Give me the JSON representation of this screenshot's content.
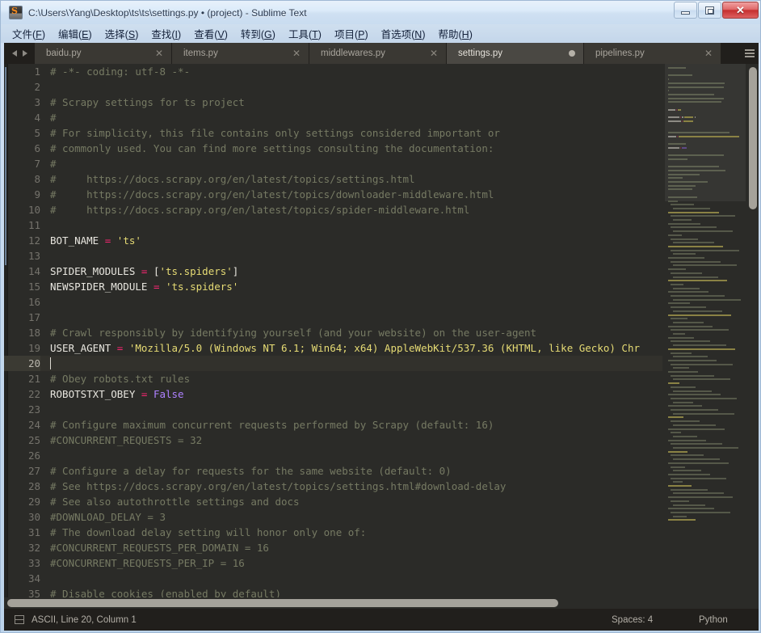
{
  "window": {
    "title": "C:\\Users\\Yang\\Desktop\\ts\\ts\\settings.py • (project) - Sublime Text",
    "icon": "sublime-text-icon",
    "controls": {
      "minimize": "—",
      "restore": "❐",
      "close": "✕"
    }
  },
  "menubar": {
    "items": [
      {
        "label": "文件",
        "mnemonic": "F"
      },
      {
        "label": "编辑",
        "mnemonic": "E"
      },
      {
        "label": "选择",
        "mnemonic": "S"
      },
      {
        "label": "查找",
        "mnemonic": "I"
      },
      {
        "label": "查看",
        "mnemonic": "V"
      },
      {
        "label": "转到",
        "mnemonic": "G"
      },
      {
        "label": "工具",
        "mnemonic": "T"
      },
      {
        "label": "项目",
        "mnemonic": "P"
      },
      {
        "label": "首选项",
        "mnemonic": "N"
      },
      {
        "label": "帮助",
        "mnemonic": "H"
      }
    ]
  },
  "tabs": {
    "nav_prev": "◀",
    "nav_next": "▶",
    "close_glyph": "✕",
    "items": [
      {
        "label": "baidu.py",
        "active": false,
        "dirty": false
      },
      {
        "label": "items.py",
        "active": false,
        "dirty": false
      },
      {
        "label": "middlewares.py",
        "active": false,
        "dirty": false
      },
      {
        "label": "settings.py",
        "active": true,
        "dirty": true
      },
      {
        "label": "pipelines.py",
        "active": false,
        "dirty": false
      }
    ]
  },
  "editor": {
    "cursor_line": 20,
    "lines": [
      {
        "n": 1,
        "tokens": [
          {
            "t": "cm",
            "s": "# -*- coding: utf-8 -*-"
          }
        ]
      },
      {
        "n": 2,
        "tokens": []
      },
      {
        "n": 3,
        "tokens": [
          {
            "t": "cm",
            "s": "# Scrapy settings for ts project"
          }
        ]
      },
      {
        "n": 4,
        "tokens": [
          {
            "t": "cm",
            "s": "#"
          }
        ]
      },
      {
        "n": 5,
        "tokens": [
          {
            "t": "cm",
            "s": "# For simplicity, this file contains only settings considered important or"
          }
        ]
      },
      {
        "n": 6,
        "tokens": [
          {
            "t": "cm",
            "s": "# commonly used. You can find more settings consulting the documentation:"
          }
        ]
      },
      {
        "n": 7,
        "tokens": [
          {
            "t": "cm",
            "s": "#"
          }
        ]
      },
      {
        "n": 8,
        "tokens": [
          {
            "t": "cm",
            "s": "#     https://docs.scrapy.org/en/latest/topics/settings.html"
          }
        ]
      },
      {
        "n": 9,
        "tokens": [
          {
            "t": "cm",
            "s": "#     https://docs.scrapy.org/en/latest/topics/downloader-middleware.html"
          }
        ]
      },
      {
        "n": 10,
        "tokens": [
          {
            "t": "cm",
            "s": "#     https://docs.scrapy.org/en/latest/topics/spider-middleware.html"
          }
        ]
      },
      {
        "n": 11,
        "tokens": []
      },
      {
        "n": 12,
        "tokens": [
          {
            "t": "var",
            "s": "BOT_NAME "
          },
          {
            "t": "op",
            "s": "="
          },
          {
            "t": "str",
            "s": " 'ts'"
          }
        ]
      },
      {
        "n": 13,
        "tokens": []
      },
      {
        "n": 14,
        "tokens": [
          {
            "t": "var",
            "s": "SPIDER_MODULES "
          },
          {
            "t": "op",
            "s": "="
          },
          {
            "t": "var",
            "s": " ["
          },
          {
            "t": "str",
            "s": "'ts.spiders'"
          },
          {
            "t": "var",
            "s": "]"
          }
        ]
      },
      {
        "n": 15,
        "tokens": [
          {
            "t": "var",
            "s": "NEWSPIDER_MODULE "
          },
          {
            "t": "op",
            "s": "="
          },
          {
            "t": "str",
            "s": " 'ts.spiders'"
          }
        ]
      },
      {
        "n": 16,
        "tokens": []
      },
      {
        "n": 17,
        "tokens": []
      },
      {
        "n": 18,
        "tokens": [
          {
            "t": "cm",
            "s": "# Crawl responsibly by identifying yourself (and your website) on the user-agent"
          }
        ]
      },
      {
        "n": 19,
        "tokens": [
          {
            "t": "var",
            "s": "USER_AGENT "
          },
          {
            "t": "op",
            "s": "="
          },
          {
            "t": "str",
            "s": " 'Mozilla/5.0 (Windows NT 6.1; Win64; x64) AppleWebKit/537.36 (KHTML, like Gecko) Chr"
          }
        ]
      },
      {
        "n": 20,
        "tokens": [],
        "cursor": true
      },
      {
        "n": 21,
        "tokens": [
          {
            "t": "cm",
            "s": "# Obey robots.txt rules"
          }
        ]
      },
      {
        "n": 22,
        "tokens": [
          {
            "t": "var",
            "s": "ROBOTSTXT_OBEY "
          },
          {
            "t": "op",
            "s": "="
          },
          {
            "t": "kw",
            "s": " False"
          }
        ]
      },
      {
        "n": 23,
        "tokens": []
      },
      {
        "n": 24,
        "tokens": [
          {
            "t": "cm",
            "s": "# Configure maximum concurrent requests performed by Scrapy (default: 16)"
          }
        ]
      },
      {
        "n": 25,
        "tokens": [
          {
            "t": "cm",
            "s": "#CONCURRENT_REQUESTS = 32"
          }
        ]
      },
      {
        "n": 26,
        "tokens": []
      },
      {
        "n": 27,
        "tokens": [
          {
            "t": "cm",
            "s": "# Configure a delay for requests for the same website (default: 0)"
          }
        ]
      },
      {
        "n": 28,
        "tokens": [
          {
            "t": "cm",
            "s": "# See https://docs.scrapy.org/en/latest/topics/settings.html#download-delay"
          }
        ]
      },
      {
        "n": 29,
        "tokens": [
          {
            "t": "cm",
            "s": "# See also autothrottle settings and docs"
          }
        ]
      },
      {
        "n": 30,
        "tokens": [
          {
            "t": "cm",
            "s": "#DOWNLOAD_DELAY = 3"
          }
        ]
      },
      {
        "n": 31,
        "tokens": [
          {
            "t": "cm",
            "s": "# The download delay setting will honor only one of:"
          }
        ]
      },
      {
        "n": 32,
        "tokens": [
          {
            "t": "cm",
            "s": "#CONCURRENT_REQUESTS_PER_DOMAIN = 16"
          }
        ]
      },
      {
        "n": 33,
        "tokens": [
          {
            "t": "cm",
            "s": "#CONCURRENT_REQUESTS_PER_IP = 16"
          }
        ]
      },
      {
        "n": 34,
        "tokens": []
      },
      {
        "n": 35,
        "tokens": [
          {
            "t": "cm",
            "s": "# Disable cookies (enabled by default)"
          }
        ]
      }
    ]
  },
  "statusbar": {
    "panel_icon": "panel-toggle-icon",
    "position": "ASCII, Line 20, Column 1",
    "indentation": "Spaces: 4",
    "syntax": "Python"
  },
  "colors": {
    "background": "#2b2b28",
    "comment": "#767a63",
    "string": "#e6db74",
    "operator": "#f92672",
    "keyword": "#ae81ff",
    "variable": "#e8e6df",
    "line_number": "#75736c",
    "current_line": "#32312c",
    "tab_active": "#4a4843",
    "tab_inactive": "#3a3833",
    "chrome": "#211f1c",
    "scrollbar": "#a5a29a"
  }
}
